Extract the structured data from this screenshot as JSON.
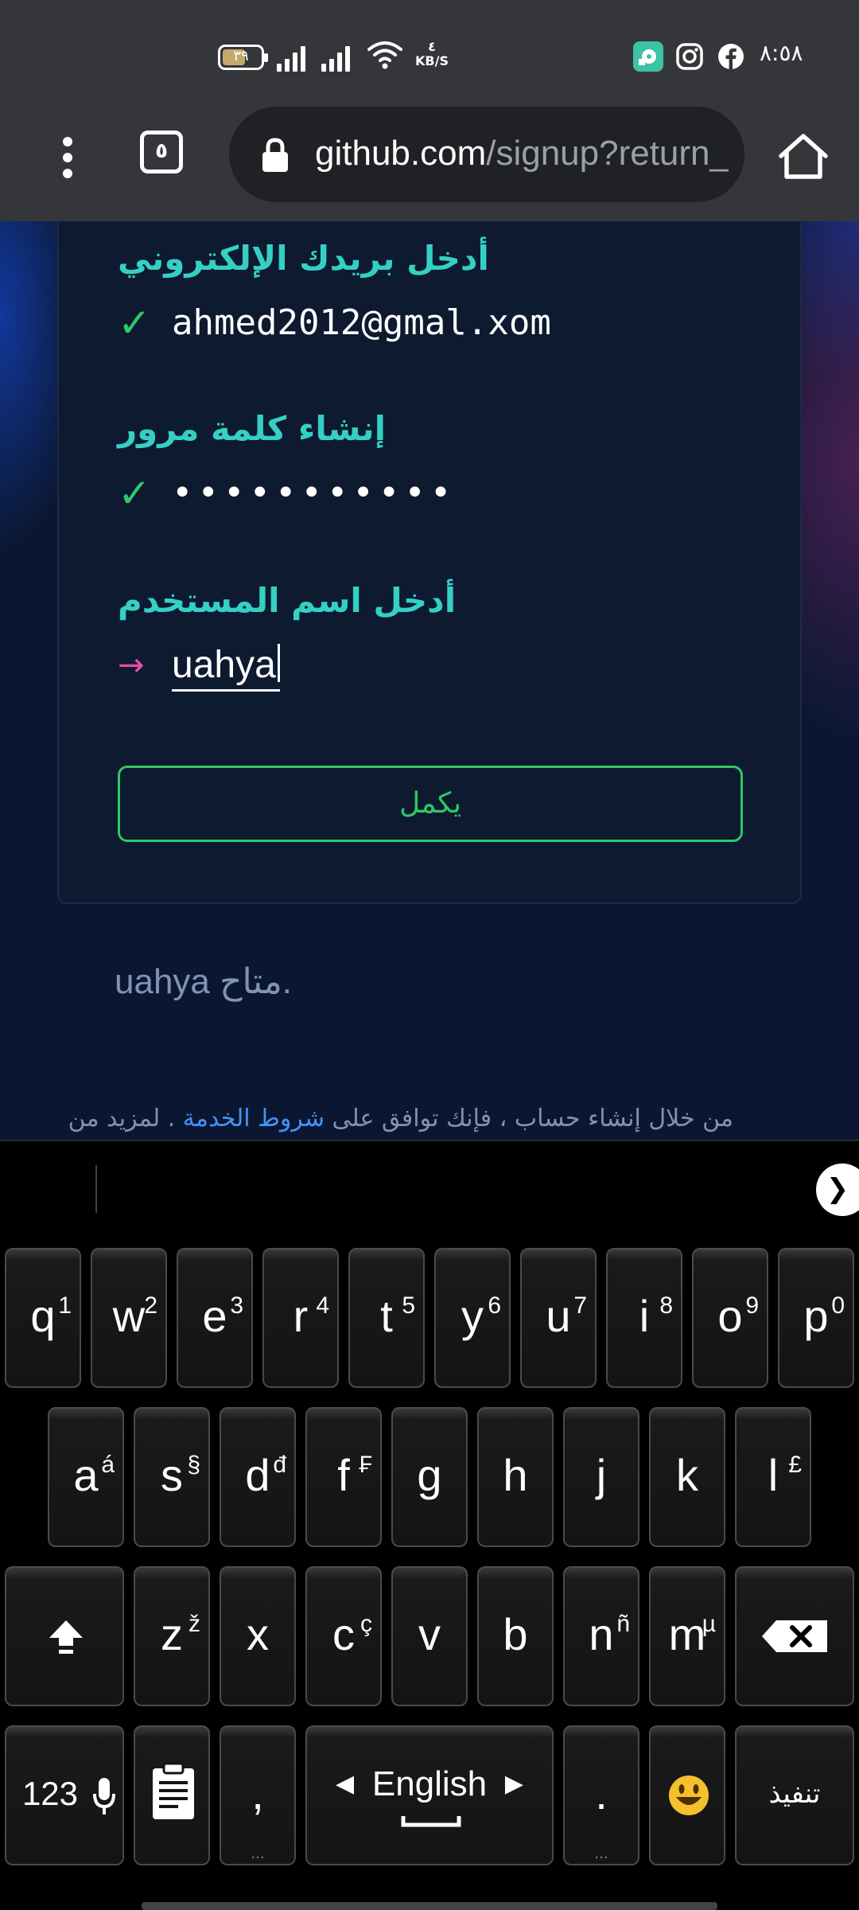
{
  "status_bar": {
    "battery_level": "٣٩",
    "net_speed_value": "٤",
    "net_speed_unit": "KB/S",
    "time": "٨:٥٨"
  },
  "toolbar": {
    "tab_count": "٥",
    "url_host": "github.com",
    "url_path": "/signup?return_to"
  },
  "form": {
    "email_label": "أدخل بريدك الإلكتروني",
    "email_mark": "✓",
    "email_value": "ahmed2012@gmal.xom",
    "password_label": "إنشاء كلمة مرور",
    "password_mark": "✓",
    "password_value": "•••••••••••",
    "username_label": "أدخل اسم المستخدم",
    "username_mark": "→",
    "username_value": "uahya",
    "continue_label": "يكمل"
  },
  "availability_text": "uahya متاح.",
  "terms": {
    "prefix": "من خلال إنشاء حساب ، فإنك توافق على ",
    "link": "شروط الخدمة",
    "suffix": " . لمزيد من"
  },
  "keyboard": {
    "expand_label": "❯",
    "rows": [
      [
        {
          "main": "q",
          "sub": "1"
        },
        {
          "main": "w",
          "sub": "2"
        },
        {
          "main": "e",
          "sub": "3"
        },
        {
          "main": "r",
          "sub": "4"
        },
        {
          "main": "t",
          "sub": "5"
        },
        {
          "main": "y",
          "sub": "6"
        },
        {
          "main": "u",
          "sub": "7"
        },
        {
          "main": "i",
          "sub": "8"
        },
        {
          "main": "o",
          "sub": "9"
        },
        {
          "main": "p",
          "sub": "0"
        }
      ],
      [
        {
          "main": "a",
          "sub": "á"
        },
        {
          "main": "s",
          "sub": "§"
        },
        {
          "main": "d",
          "sub": "đ"
        },
        {
          "main": "f",
          "sub": "₣"
        },
        {
          "main": "g",
          "sub": ""
        },
        {
          "main": "h",
          "sub": ""
        },
        {
          "main": "j",
          "sub": ""
        },
        {
          "main": "k",
          "sub": ""
        },
        {
          "main": "l",
          "sub": "£"
        }
      ],
      [
        {
          "main": "z",
          "sub": "ž"
        },
        {
          "main": "x",
          "sub": ""
        },
        {
          "main": "c",
          "sub": "ç"
        },
        {
          "main": "v",
          "sub": ""
        },
        {
          "main": "b",
          "sub": ""
        },
        {
          "main": "n",
          "sub": "ñ"
        },
        {
          "main": "m",
          "sub": "µ"
        }
      ]
    ],
    "symbols_label": "123",
    "comma_label": ",",
    "space_label": "English",
    "period_label": ".",
    "emoji_label": "😃",
    "enter_label": "تنفيذ"
  }
}
